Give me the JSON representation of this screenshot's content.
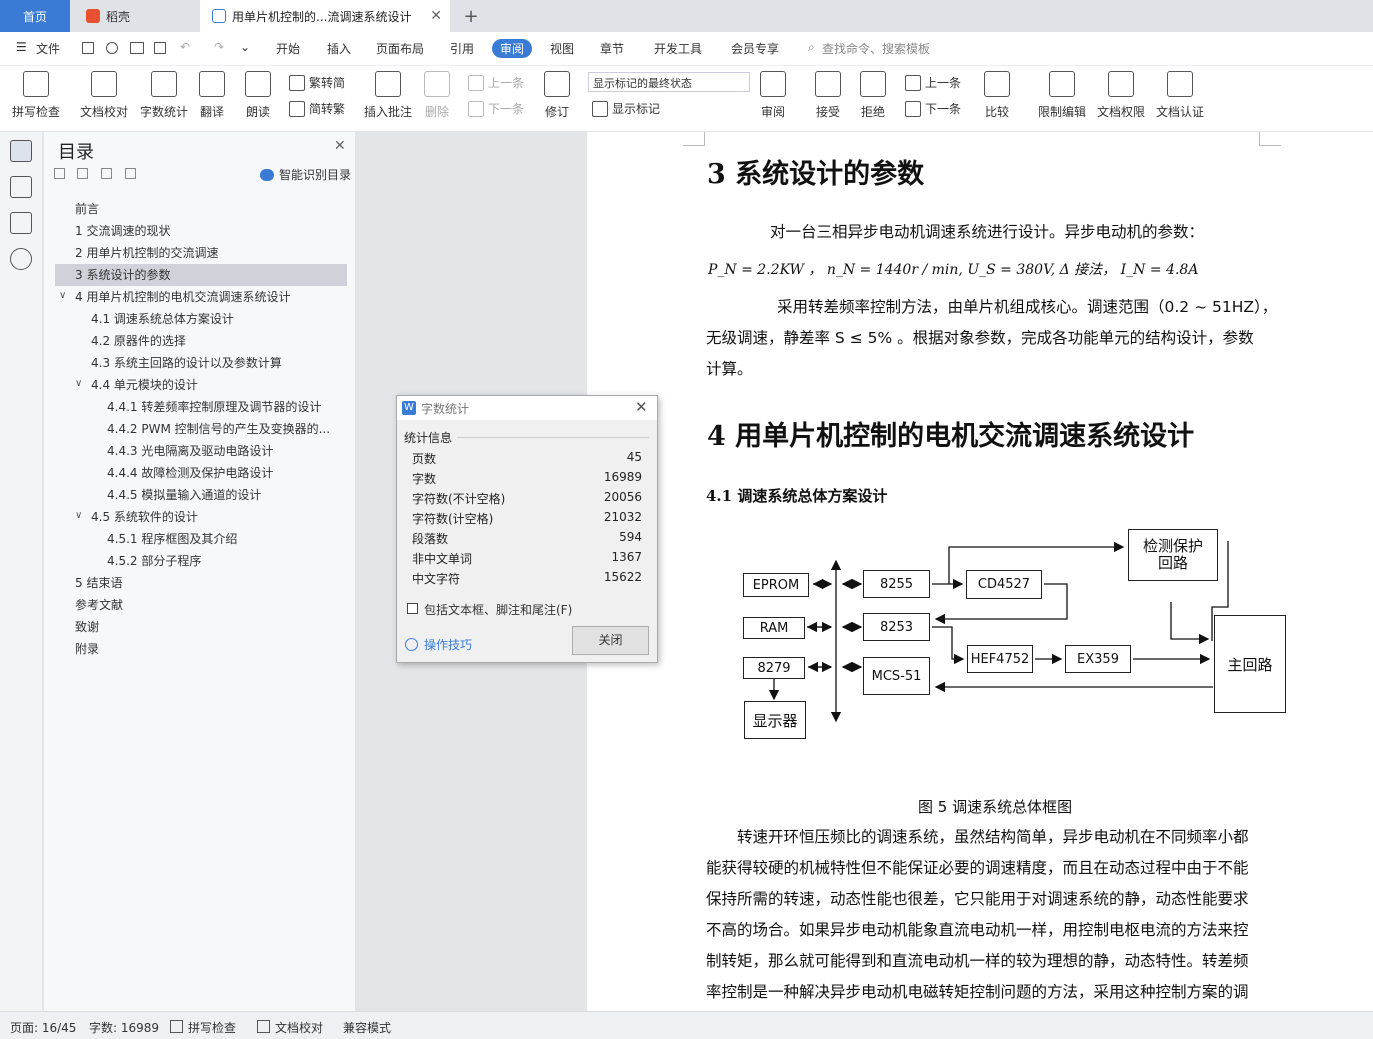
{
  "tabs": {
    "home": "首页",
    "daoke": "稻壳",
    "document": "用单片机控制的...流调速系统设计"
  },
  "menu": {
    "file": "文件",
    "items": [
      "开始",
      "插入",
      "页面布局",
      "引用",
      "审阅",
      "视图",
      "章节",
      "开发工具",
      "会员专享"
    ],
    "search": "查找命令、搜索模板"
  },
  "ribbon": {
    "spellcheck": "拼写检查",
    "doccheck": "文档校对",
    "wordcount": "字数统计",
    "translate": "翻译",
    "read": "朗读",
    "trad": "繁转简",
    "simp": "简转繁",
    "comment": "插入批注",
    "delete": "删除",
    "prev": "上一条",
    "next": "下一条",
    "revise": "修订",
    "markstate": "显示标记的最终状态",
    "showmark": "显示标记",
    "review": "审阅",
    "accept": "接受",
    "reject": "拒绝",
    "prev2": "上一条",
    "next2": "下一条",
    "compare": "比较",
    "restrict": "限制编辑",
    "perm": "文档权限",
    "auth": "文档认证"
  },
  "toc": {
    "title": "目录",
    "smart": "智能识别目录",
    "items": [
      "前言",
      "1   交流调速的现状",
      "2   用单片机控制的交流调速",
      "3   系统设计的参数",
      "4   用单片机控制的电机交流调速系统设计",
      "4.1  调速系统总体方案设计",
      "4.2  原器件的选择",
      "4.3  系统主回路的设计以及参数计算",
      "4.4  单元模块的设计",
      "4.4.1    转差频率控制原理及调节器的设计",
      "4.4.2    PWM 控制信号的产生及变换器的...",
      "4.4.3    光电隔离及驱动电路设计",
      "4.4.4    故障检测及保护电路设计",
      "4.4.5    模拟量输入通道的设计",
      "4.5  系统软件的设计",
      "4.5.1    程序框图及其介绍",
      "4.5.2    部分子程序",
      "5   结束语",
      "参考文献",
      "致谢",
      "附录"
    ]
  },
  "dialog": {
    "title": "字数统计",
    "section": "统计信息",
    "rows": [
      {
        "label": "页数",
        "value": "45"
      },
      {
        "label": "字数",
        "value": "16989"
      },
      {
        "label": "字符数(不计空格)",
        "value": "20056"
      },
      {
        "label": "字符数(计空格)",
        "value": "21032"
      },
      {
        "label": "段落数",
        "value": "594"
      },
      {
        "label": "非中文单词",
        "value": "1367"
      },
      {
        "label": "中文字符",
        "value": "15622"
      }
    ],
    "include": "包括文本框、脚注和尾注(F)",
    "tips": "操作技巧",
    "close": "关闭"
  },
  "doc": {
    "h3": "3    系统设计的参数",
    "p1": "对一台三相异步电动机调速系统进行设计。异步电动机的参数：",
    "math": "P_N = 2.2KW ，  n_N = 1440r / min, U_S = 380V, Δ 接法，  I_N = 4.8A",
    "p2a": "采用转差频率控制方法，由单片机组成核心。调速范围（0.2 ~ 51HZ），",
    "p2b": "无级调速，静差率 S ≤ 5% 。根据对象参数，完成各功能单元的结构设计，参数",
    "p2c": "计算。",
    "h4": "4    用单片机控制的电机交流调速系统设计",
    "h41": "4.1  调速系统总体方案设计",
    "caption": "图 5  调速系统总体框图",
    "p3": [
      "转速开环恒压频比的调速系统，虽然结构简单，异步电动机在不同频率小都",
      "能获得较硬的机械特性但不能保证必要的调速精度，而且在动态过程中由于不能",
      "保持所需的转速，动态性能也很差，它只能用于对调速系统的静，动态性能要求",
      "不高的场合。如果异步电动机能象直流电动机一样，用控制电枢电流的方法来控",
      "制转矩，那么就可能得到和直流电动机一样的较为理想的静，动态特性。转差频",
      "率控制是一种解决异步电动机电磁转矩控制问题的方法，采用这种控制方案的调"
    ]
  },
  "diagram": {
    "eprom": "EPROM",
    "ram": "RAM",
    "c8279": "8279",
    "display": "显示器",
    "c8255": "8255",
    "c8253": "8253",
    "mcs51": "MCS-51",
    "cd4527": "CD4527",
    "hef": "HEF4752",
    "ex": "EX359",
    "detect": "检测保护回路",
    "main": "主回路"
  },
  "status": {
    "page": "页面: 16/45",
    "words": "字数: 16989",
    "spell": "拼写检查",
    "check": "文档校对",
    "compat": "兼容模式"
  }
}
